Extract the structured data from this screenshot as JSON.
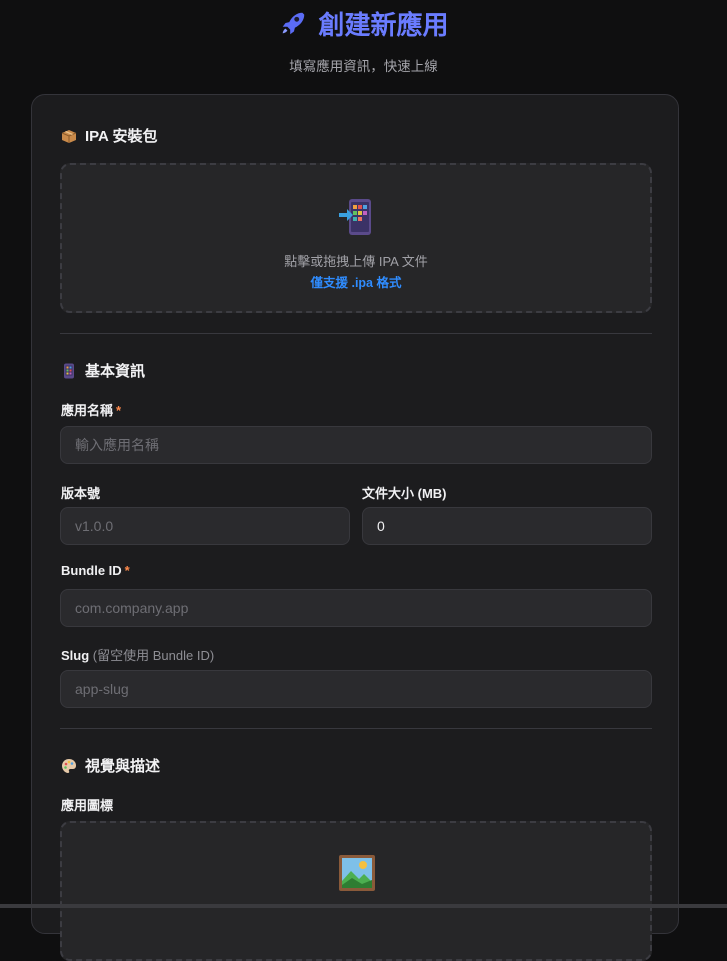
{
  "header": {
    "title": "創建新應用",
    "subtitle": "填寫應用資訊，快速上線"
  },
  "ipa_section": {
    "title": "IPA 安裝包",
    "icon": "package-icon",
    "dropzone": {
      "icon": "app-import-icon",
      "text": "點擊或拖拽上傳 IPA 文件",
      "hint": "僅支援 .ipa 格式"
    }
  },
  "basic_section": {
    "title": "基本資訊",
    "icon": "phone-icon",
    "app_name": {
      "label": "應用名稱",
      "required": "*",
      "placeholder": "輸入應用名稱",
      "value": ""
    },
    "version": {
      "label": "版本號",
      "placeholder": "v1.0.0",
      "value": ""
    },
    "file_size": {
      "label": "文件大小 (MB)",
      "value": "0"
    },
    "bundle_id": {
      "label": "Bundle ID",
      "required": "*",
      "placeholder": "com.company.app",
      "value": ""
    },
    "slug": {
      "label": "Slug",
      "hint": "(留空使用 Bundle ID)",
      "placeholder": "app-slug",
      "value": ""
    }
  },
  "visual_section": {
    "title": "視覺與描述",
    "icon": "palette-icon",
    "app_icon": {
      "label": "應用圖標",
      "dropzone_icon": "picture-icon"
    }
  },
  "colors": {
    "accent": "#6a7cff",
    "link": "#2f8cff",
    "required": "#ff8a4c",
    "background": "#0f0f10",
    "card": "#1c1c1e"
  }
}
